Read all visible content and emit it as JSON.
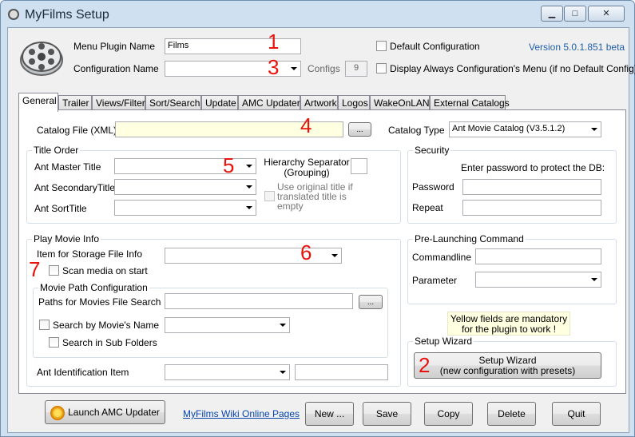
{
  "window": {
    "title": "MyFilms Setup",
    "minimize": "▁",
    "maximize": "□",
    "close": "✕"
  },
  "header": {
    "menu_plugin_name_label": "Menu Plugin Name",
    "menu_plugin_name_value": "Films",
    "configuration_name_label": "Configuration Name",
    "configuration_name_value": "",
    "configs_label": "Configs",
    "configs_value": "9",
    "default_configuration_label": "Default Configuration",
    "display_always_label": "Display Always Configuration's Menu (if no Default Config)",
    "version": "Version 5.0.1.851 beta"
  },
  "tabs": [
    "General",
    "Trailer",
    "Views/Filter",
    "Sort/Search",
    "Update",
    "AMC Updater",
    "Artwork",
    "Logos",
    "WakeOnLAN",
    "External Catalogs"
  ],
  "general": {
    "catalog_file_label": "Catalog File (XML)",
    "catalog_file_value": "",
    "browse_label": "...",
    "catalog_type_label": "Catalog Type",
    "catalog_type_value": "Ant Movie Catalog (V3.5.1.2)",
    "title_order": {
      "title": "Title Order",
      "master_title_label": "Ant Master Title",
      "secondary_title_label": "Ant SecondaryTitle",
      "sort_title_label": "Ant SortTitle",
      "hierarchy_separator_label": "Hierarchy Separator\n(Grouping)",
      "use_original_title_label": "Use original title if translated title is empty"
    },
    "security": {
      "title": "Security",
      "hint": "Enter password to protect the DB:",
      "password_label": "Password",
      "repeat_label": "Repeat"
    },
    "play_movie_info": {
      "title": "Play Movie Info",
      "item_for_storage_label": "Item for Storage  File Info",
      "scan_media_label": "Scan media on start",
      "movie_path_title": "Movie Path Configuration",
      "paths_label": "Paths for Movies File Search",
      "browse_label": "...",
      "search_by_name_label": "Search by Movie's Name",
      "search_sub_folders_label": "Search in Sub Folders",
      "ant_identification_label": "Ant Identification Item"
    },
    "pre_launching": {
      "title": "Pre-Launching Command",
      "commandline_label": "Commandline",
      "parameter_label": "Parameter"
    },
    "mandatory_note": "Yellow fields are mandatory\nfor the plugin to work !",
    "setup_wizard": {
      "title": "Setup Wizard",
      "button_label": "Setup Wizard\n(new configuration with presets)"
    }
  },
  "annotations": [
    "1",
    "2",
    "3",
    "4",
    "5",
    "6",
    "7"
  ],
  "footer": {
    "launch_amc_label": "Launch AMC Updater",
    "wiki_link": "MyFilms Wiki Online Pages",
    "new_label": "New ...",
    "save_label": "Save",
    "copy_label": "Copy",
    "delete_label": "Delete",
    "quit_label": "Quit"
  },
  "colors": {
    "mandatory_yellow": "#ffffe1",
    "annotation_red": "#e8140c",
    "link_blue": "#0645ad",
    "version_blue": "#1f5fa8"
  }
}
